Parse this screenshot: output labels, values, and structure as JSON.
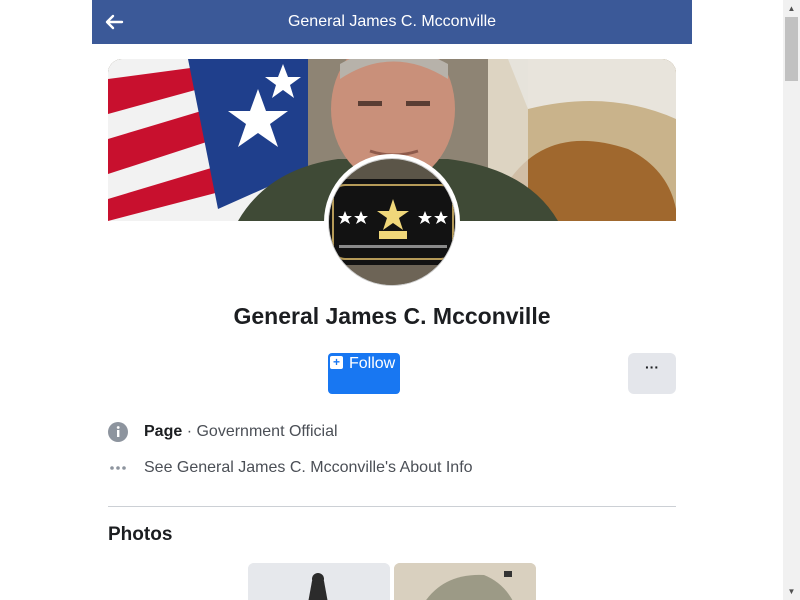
{
  "header": {
    "title": "General James C. Mcconville",
    "back_icon": "arrow-left-icon"
  },
  "profile": {
    "name": "General James C. Mcconville",
    "follow_label": "Follow",
    "more_label": "···"
  },
  "info": {
    "category_label": "Page",
    "separator": " · ",
    "category_value": "Government Official",
    "about_text": "See General James C. Mcconville's About Info",
    "icons": [
      "info-circle-icon",
      "ellipsis-icon"
    ]
  },
  "photos": {
    "title": "Photos"
  },
  "colors": {
    "header_bg": "#3b5998",
    "follow_bg": "#1877f2",
    "more_bg": "#e4e6eb"
  }
}
